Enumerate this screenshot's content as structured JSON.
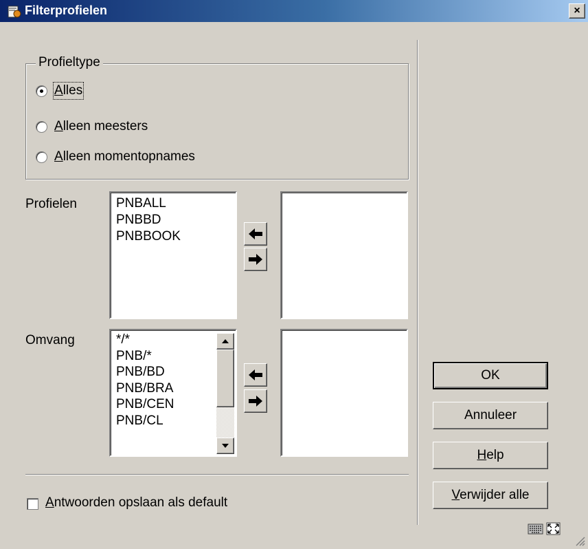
{
  "window": {
    "title": "Filterprofielen",
    "close_glyph": "×"
  },
  "profieltype": {
    "legend": "Profieltype",
    "options": [
      {
        "accel": "A",
        "rest": "lles",
        "checked": true
      },
      {
        "accel": "A",
        "rest": "lleen meesters",
        "checked": false
      },
      {
        "accel": "A",
        "rest": "lleen momentopnames",
        "checked": false
      }
    ]
  },
  "profielen": {
    "label": "Profielen",
    "available": [
      "PNBALL",
      "PNBBD",
      "PNBBOOK"
    ],
    "selected": []
  },
  "omvang": {
    "label": "Omvang",
    "available": [
      "*/*",
      "PNB/*",
      "PNB/BD",
      "PNB/BRA",
      "PNB/CEN",
      "PNB/CL"
    ],
    "selected": []
  },
  "default_checkbox": {
    "accel": "A",
    "rest": "ntwoorden opslaan als default",
    "checked": false
  },
  "buttons": {
    "ok": "OK",
    "cancel": "Annuleer",
    "help_accel": "H",
    "help_rest": "elp",
    "delete_accel": "V",
    "delete_rest": "erwijder alle"
  },
  "icons": {
    "move_left": "arrow-left-icon",
    "move_right": "arrow-right-icon",
    "keyboard": "keyboard-icon",
    "maximize": "maximize-icon"
  }
}
